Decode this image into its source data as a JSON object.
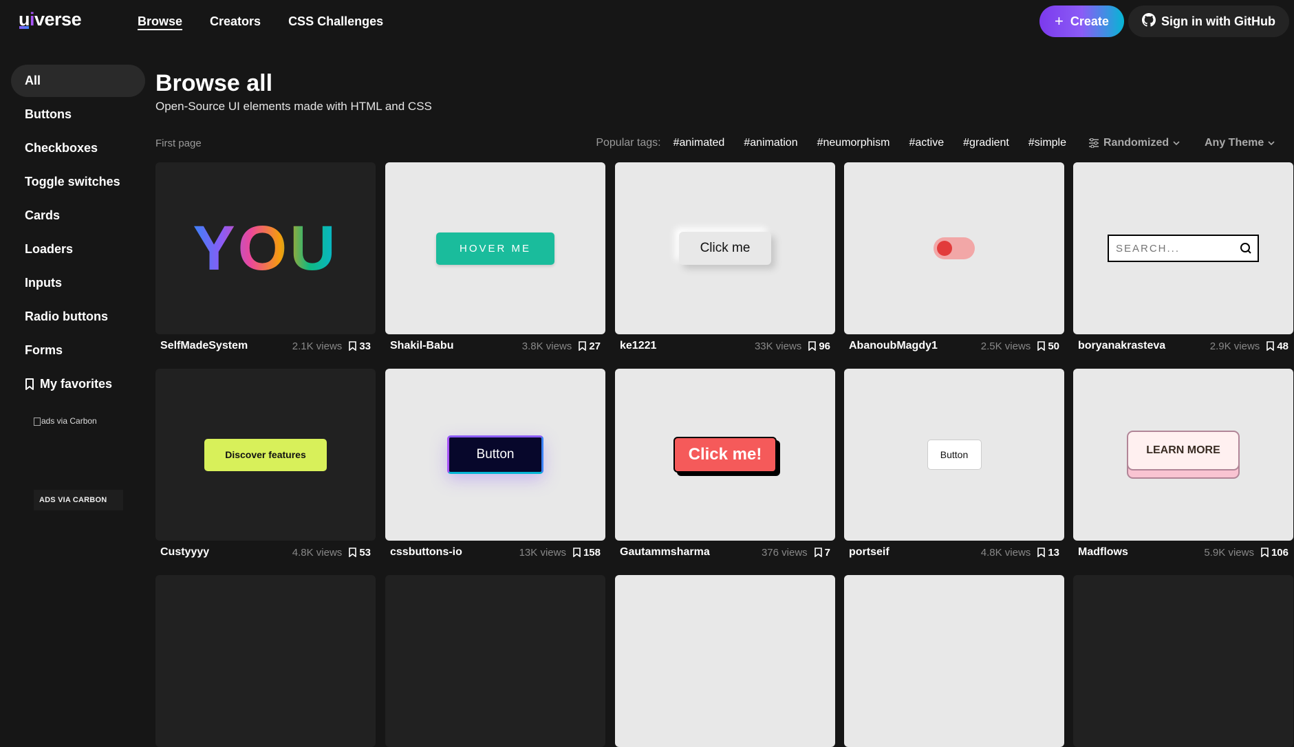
{
  "header": {
    "logo": {
      "u": "u",
      "i": "i",
      "rest": "verse"
    },
    "nav": [
      {
        "label": "Browse"
      },
      {
        "label": "Creators"
      },
      {
        "label": "CSS Challenges"
      }
    ],
    "create_label": "Create",
    "github_label": "Sign in with GitHub"
  },
  "sidebar": {
    "items": [
      {
        "label": "All"
      },
      {
        "label": "Buttons"
      },
      {
        "label": "Checkboxes"
      },
      {
        "label": "Toggle switches"
      },
      {
        "label": "Cards"
      },
      {
        "label": "Loaders"
      },
      {
        "label": "Inputs"
      },
      {
        "label": "Radio buttons"
      },
      {
        "label": "Forms"
      },
      {
        "label": "My favorites"
      }
    ],
    "carbon_img_alt": "ads via Carbon",
    "carbon_label": "ADS VIA CARBON"
  },
  "main": {
    "title": "Browse all",
    "subtitle": "Open-Source UI elements made with HTML and CSS",
    "first_page": "First page",
    "tags_label": "Popular tags:",
    "tags": [
      "#animated",
      "#animation",
      "#neumorphism",
      "#active",
      "#gradient",
      "#simple"
    ],
    "sort_label": "Randomized",
    "theme_label": "Any Theme"
  },
  "cards": [
    {
      "author": "SelfMadeSystem",
      "views": "2.1K views",
      "saves": "33",
      "preview_text": "YOU"
    },
    {
      "author": "Shakil-Babu",
      "views": "3.8K views",
      "saves": "27",
      "preview_text": "HOVER ME"
    },
    {
      "author": "ke1221",
      "views": "33K views",
      "saves": "96",
      "preview_text": "Click me"
    },
    {
      "author": "AbanoubMagdy1",
      "views": "2.5K views",
      "saves": "50",
      "preview_text": ""
    },
    {
      "author": "boryanakrasteva",
      "views": "2.9K views",
      "saves": "48",
      "preview_text": "SEARCH..."
    },
    {
      "author": "Custyyyy",
      "views": "4.8K views",
      "saves": "53",
      "preview_text": "Discover features"
    },
    {
      "author": "cssbuttons-io",
      "views": "13K views",
      "saves": "158",
      "preview_text": "Button"
    },
    {
      "author": "Gautammsharma",
      "views": "376 views",
      "saves": "7",
      "preview_text": "Click me!"
    },
    {
      "author": "portseif",
      "views": "4.8K views",
      "saves": "13",
      "preview_text": "Button"
    },
    {
      "author": "Madflows",
      "views": "5.9K views",
      "saves": "106",
      "preview_text": "LEARN MORE"
    }
  ],
  "colors": {
    "background": "#161616",
    "accent_gradient_start": "#7c3aed",
    "accent_gradient_end": "#06b6d4"
  }
}
